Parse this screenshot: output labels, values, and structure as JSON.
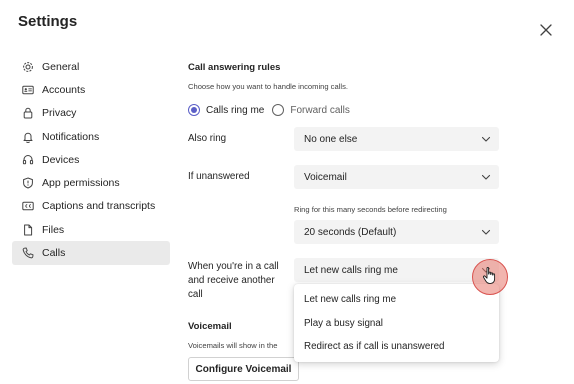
{
  "window": {
    "title": "Settings",
    "close_icon": "close-icon"
  },
  "sidebar": {
    "items": [
      {
        "label": "General",
        "icon": "gear-icon",
        "active": false
      },
      {
        "label": "Accounts",
        "icon": "id-card-icon",
        "active": false
      },
      {
        "label": "Privacy",
        "icon": "lock-icon",
        "active": false
      },
      {
        "label": "Notifications",
        "icon": "bell-icon",
        "active": false
      },
      {
        "label": "Devices",
        "icon": "headset-icon",
        "active": false
      },
      {
        "label": "App permissions",
        "icon": "shield-icon",
        "active": false
      },
      {
        "label": "Captions and transcripts",
        "icon": "cc-icon",
        "active": false
      },
      {
        "label": "Files",
        "icon": "file-icon",
        "active": false
      },
      {
        "label": "Calls",
        "icon": "phone-icon",
        "active": true
      }
    ]
  },
  "call_rules": {
    "heading": "Call answering rules",
    "description": "Choose how you want to handle incoming calls.",
    "radio_ring": "Calls ring me",
    "radio_forward": "Forward calls",
    "selected": "Calls ring me",
    "also_ring_label": "Also ring",
    "also_ring_value": "No one else",
    "unanswered_label": "If unanswered",
    "unanswered_value": "Voicemail",
    "ring_seconds_label": "Ring for this many seconds before redirecting",
    "ring_seconds_value": "20 seconds (Default)",
    "in_call_label_1": "When you're in a call",
    "in_call_label_2": "and receive another",
    "in_call_label_3": "call",
    "in_call_value": "Let new calls ring me",
    "in_call_options": [
      "Let new calls ring me",
      "Play a busy signal",
      "Redirect as if call is unanswered"
    ]
  },
  "voicemail": {
    "heading": "Voicemail",
    "description": "Voicemails will show in the",
    "configure_button": "Configure Voicemail"
  },
  "colors": {
    "accent": "#5b5fc7",
    "active_nav": "#eaeaea",
    "select_bg": "#f3f3f3",
    "cursor_highlight": "#e8786e"
  }
}
